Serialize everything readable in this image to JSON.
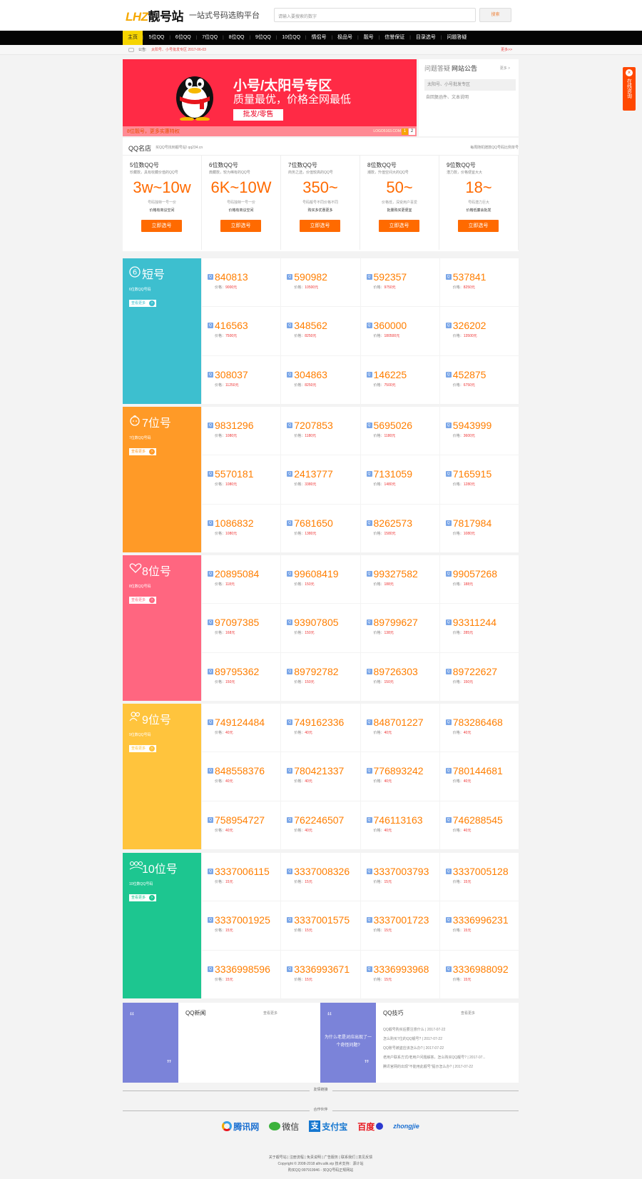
{
  "header": {
    "logo_part1": "LHZ",
    "logo_part2": "靓号站",
    "slogan": "一站式号码选购平台",
    "search_placeholder": "请输入要搜索的数字",
    "search_button": "搜索"
  },
  "nav": {
    "items": [
      "主页",
      "5位QQ",
      "6位QQ",
      "7位QQ",
      "8位QQ",
      "9位QQ",
      "10位QQ",
      "情侣号",
      "极品号",
      "靓号",
      "信誉保证",
      "目录选号",
      "问题答疑"
    ],
    "active_index": 0,
    "active_color": "#f6d400"
  },
  "notice": {
    "label": "公告:",
    "text": "太阳号、小号批发专区   2017-06-03",
    "more": "更多>>"
  },
  "banner": {
    "title": "小号/太阳号专区",
    "subtitle": "质量最优，价格全网最低",
    "button": "批发/零售",
    "bottom_text": "8位靓号，更多实惠特权",
    "bottom_domain": "LOGO5163.COM",
    "pager": [
      "1",
      "2"
    ],
    "bg_color": "#ff2a45"
  },
  "qa": {
    "tab1": "问题答疑",
    "tab2": "网站公告",
    "more": "更多 >",
    "items": [
      "太阳号、小号批发专区",
      "自回复函件、文本说明"
    ]
  },
  "store": {
    "title": "QQ名店",
    "subtitle": "买QQ号找到靓号站!  qq234.cn",
    "right_text": "每周随机赠款QQ号码比例单号",
    "tiers": [
      {
        "name": "5位数QQ号",
        "desc": "珍藏款，具有收藏价值的QQ号",
        "price": "3w~10w",
        "line1": "号码独特一号一价",
        "line2": "价格有商议空间",
        "button": "立即选号"
      },
      {
        "name": "6位数QQ号",
        "desc": "典藏款，较为稀有的QQ号",
        "price": "6K~10W",
        "line1": "号码独特一号一价",
        "line2": "价格有商议空间",
        "button": "立即选号"
      },
      {
        "name": "7位数QQ号",
        "desc": "商务之选，价值较高的QQ号",
        "price": "350~",
        "line1": "号码靓号不同价格不同",
        "line2": "购买多优惠更多",
        "button": "立即选号"
      },
      {
        "name": "8位数QQ号",
        "desc": "潮款，升值空间大的QQ号",
        "price": "50~",
        "line1": "价格低，深受用户喜爱",
        "line2": "批量购买更便宜",
        "button": "立即选号"
      },
      {
        "name": "9位数QQ号",
        "desc": "潜力款，价格便宜大大",
        "price": "18~",
        "line1": "号码潜力巨大",
        "line2": "价格低廉会批发",
        "button": "立即选号"
      }
    ]
  },
  "sections": [
    {
      "title": "短号",
      "desc": "6位数QQ号码",
      "more": "查看更多",
      "color": "#3dbfcf",
      "icon": "number-6-icon",
      "items": [
        {
          "number": "840813",
          "price": "9000"
        },
        {
          "number": "590982",
          "price": "10500"
        },
        {
          "number": "592357",
          "price": "9750"
        },
        {
          "number": "537841",
          "price": "8250"
        },
        {
          "number": "416563",
          "price": "7500"
        },
        {
          "number": "348562",
          "price": "8250"
        },
        {
          "number": "360000",
          "price": "180500"
        },
        {
          "number": "326202",
          "price": "13500"
        },
        {
          "number": "308037",
          "price": "11250"
        },
        {
          "number": "304863",
          "price": "8250"
        },
        {
          "number": "146225",
          "price": "7500"
        },
        {
          "number": "452875",
          "price": "6750"
        }
      ]
    },
    {
      "title": "7位号",
      "desc": "7位数QQ号码",
      "more": "查看更多",
      "color": "#ff9a27",
      "icon": "baby-face-icon",
      "items": [
        {
          "number": "9831296",
          "price": "1080"
        },
        {
          "number": "7207853",
          "price": "1180"
        },
        {
          "number": "5695026",
          "price": "1180"
        },
        {
          "number": "5943999",
          "price": "3600"
        },
        {
          "number": "5570181",
          "price": "1080"
        },
        {
          "number": "2413777",
          "price": "3380"
        },
        {
          "number": "7131059",
          "price": "1480"
        },
        {
          "number": "7165915",
          "price": "1280"
        },
        {
          "number": "1086832",
          "price": "1080"
        },
        {
          "number": "7681650",
          "price": "1380"
        },
        {
          "number": "8262573",
          "price": "1580"
        },
        {
          "number": "7817984",
          "price": "1080"
        }
      ]
    },
    {
      "title": "8位号",
      "desc": "8位数QQ号码",
      "more": "查看更多",
      "color": "#ff6680",
      "icon": "hearts-icon",
      "items": [
        {
          "number": "20895084",
          "price": "118"
        },
        {
          "number": "99608419",
          "price": "150"
        },
        {
          "number": "99327582",
          "price": "188"
        },
        {
          "number": "99057268",
          "price": "188"
        },
        {
          "number": "97097385",
          "price": "168"
        },
        {
          "number": "93907805",
          "price": "150"
        },
        {
          "number": "89799627",
          "price": "138"
        },
        {
          "number": "93311244",
          "price": "285"
        },
        {
          "number": "89795362",
          "price": "150"
        },
        {
          "number": "89792782",
          "price": "150"
        },
        {
          "number": "89726303",
          "price": "150"
        },
        {
          "number": "89722627",
          "price": "150"
        }
      ]
    },
    {
      "title": "9位号",
      "desc": "9位数QQ号码",
      "more": "查看更多",
      "color": "#ffc43d",
      "icon": "users-icon",
      "items": [
        {
          "number": "749124484",
          "price": "40"
        },
        {
          "number": "749162336",
          "price": "40"
        },
        {
          "number": "848701227",
          "price": "40"
        },
        {
          "number": "783286468",
          "price": "40"
        },
        {
          "number": "848558376",
          "price": "40"
        },
        {
          "number": "780421337",
          "price": "40"
        },
        {
          "number": "776893242",
          "price": "40"
        },
        {
          "number": "780144681",
          "price": "40"
        },
        {
          "number": "758954727",
          "price": "40"
        },
        {
          "number": "762246507",
          "price": "40"
        },
        {
          "number": "746113163",
          "price": "40"
        },
        {
          "number": "746288545",
          "price": "40"
        }
      ]
    },
    {
      "title": "10位号",
      "desc": "10位数QQ号码",
      "more": "查看更多",
      "color": "#1dc690",
      "icon": "group-icon",
      "items": [
        {
          "number": "3337006115",
          "price": "15"
        },
        {
          "number": "3337008326",
          "price": "15"
        },
        {
          "number": "3337003793",
          "price": "15"
        },
        {
          "number": "3337005128",
          "price": "15"
        },
        {
          "number": "3337001925",
          "price": "15"
        },
        {
          "number": "3337001575",
          "price": "15"
        },
        {
          "number": "3337001723",
          "price": "15"
        },
        {
          "number": "3336996231",
          "price": "15"
        },
        {
          "number": "3336998596",
          "price": "15"
        },
        {
          "number": "3336993671",
          "price": "15"
        },
        {
          "number": "3336993968",
          "price": "15"
        },
        {
          "number": "3336988092",
          "price": "15"
        }
      ]
    }
  ],
  "price_label": "价格：",
  "price_unit": "元",
  "news": {
    "left_title": "QQ新闻",
    "left_more": "查看更多",
    "right_title": "QQ技巧",
    "right_more": "查看更多",
    "right_panel_text": "为什么老是对应出现了一个奇怪问题?",
    "right_items": [
      "QQ靓号购买后要注意什么 | 2017-07-22",
      "怎么购买7位的QQ靓号? | 2017-07-22",
      "QQ账号被盗应该怎么办? | 2017-07-22",
      "老用户联系方式/老用户问题解答，怎么购买QQ靓号? | 2017-07...",
      "腾讯官网的出现\"不能用此靓号\"提示怎么办? | 2017-07-22"
    ]
  },
  "footer": {
    "friend_links": "友情链接",
    "partners_title": "合作伙伴",
    "partners": [
      "腾讯网",
      "微信",
      "支付宝",
      "百度",
      "zhongjie"
    ],
    "links": "关于靓号站 | 注册流程 | 免责说明 | 广告服务 | 联系我们 | 意见反馈",
    "copyright": "Copyright © 2008-2018 alhv.alik.vip 技术支持：源计站",
    "contact": "购买QQ:997919946 - 买QQ号码正规网站"
  },
  "float_ad": {
    "text": "在线咨询",
    "close": "×"
  }
}
